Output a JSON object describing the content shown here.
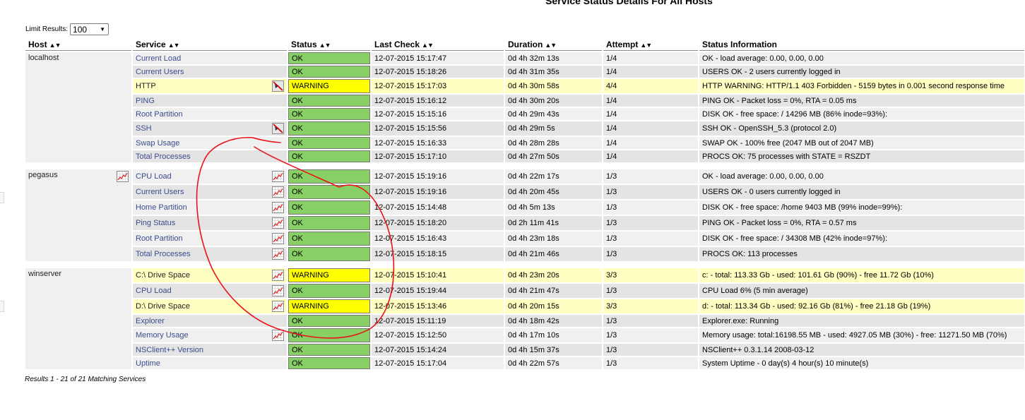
{
  "page": {
    "title": "Service Status Details For All Hosts"
  },
  "limit": {
    "label": "Limit Results:",
    "value": "100"
  },
  "columns": {
    "host": "Host",
    "service": "Service",
    "status": "Status",
    "last_check": "Last Check",
    "duration": "Duration",
    "attempt": "Attempt",
    "info": "Status Information"
  },
  "hosts": [
    {
      "name": "localhost",
      "graph_icon": false,
      "services": [
        {
          "name": "Current Load",
          "icon": "",
          "status": "OK",
          "last_check": "12-07-2015 15:17:47",
          "duration": "0d 4h 32m 13s",
          "attempt": "1/4",
          "info": "OK - load average: 0.00, 0.00, 0.00"
        },
        {
          "name": "Current Users",
          "icon": "",
          "status": "OK",
          "last_check": "12-07-2015 15:18:26",
          "duration": "0d 4h 31m 35s",
          "attempt": "1/4",
          "info": "USERS OK - 2 users currently logged in"
        },
        {
          "name": "HTTP",
          "icon": "notifications-disabled-icon",
          "status": "WARNING",
          "last_check": "12-07-2015 15:17:03",
          "duration": "0d 4h 30m 58s",
          "attempt": "4/4",
          "info": "HTTP WARNING: HTTP/1.1 403 Forbidden - 5159 bytes in 0.001 second response time"
        },
        {
          "name": "PING",
          "icon": "",
          "status": "OK",
          "last_check": "12-07-2015 15:16:12",
          "duration": "0d 4h 30m 20s",
          "attempt": "1/4",
          "info": "PING OK - Packet loss = 0%, RTA = 0.05 ms"
        },
        {
          "name": "Root Partition",
          "icon": "",
          "status": "OK",
          "last_check": "12-07-2015 15:15:16",
          "duration": "0d 4h 29m 43s",
          "attempt": "1/4",
          "info": "DISK OK - free space: / 14296 MB (86% inode=93%):"
        },
        {
          "name": "SSH",
          "icon": "notifications-disabled-icon",
          "status": "OK",
          "last_check": "12-07-2015 15:15:56",
          "duration": "0d 4h 29m 5s",
          "attempt": "1/4",
          "info": "SSH OK - OpenSSH_5.3 (protocol 2.0)"
        },
        {
          "name": "Swap Usage",
          "icon": "",
          "status": "OK",
          "last_check": "12-07-2015 15:16:33",
          "duration": "0d 4h 28m 28s",
          "attempt": "1/4",
          "info": "SWAP OK - 100% free (2047 MB out of 2047 MB)"
        },
        {
          "name": "Total Processes",
          "icon": "",
          "status": "OK",
          "last_check": "12-07-2015 15:17:10",
          "duration": "0d 4h 27m 50s",
          "attempt": "1/4",
          "info": "PROCS OK: 75 processes with STATE = RSZDT"
        }
      ]
    },
    {
      "name": "pegasus",
      "graph_icon": true,
      "services": [
        {
          "name": "CPU Load",
          "icon": "graph-icon",
          "status": "OK",
          "last_check": "12-07-2015 15:19:16",
          "duration": "0d 4h 22m 17s",
          "attempt": "1/3",
          "info": "OK - load average: 0.00, 0.00, 0.00"
        },
        {
          "name": "Current Users",
          "icon": "graph-icon",
          "status": "OK",
          "last_check": "12-07-2015 15:19:16",
          "duration": "0d 4h 20m 45s",
          "attempt": "1/3",
          "info": "USERS OK - 0 users currently logged in"
        },
        {
          "name": "Home Partition",
          "icon": "graph-icon",
          "status": "OK",
          "last_check": "12-07-2015 15:14:48",
          "duration": "0d 4h 5m 13s",
          "attempt": "1/3",
          "info": "DISK OK - free space: /home 9403 MB (99% inode=99%):"
        },
        {
          "name": "Ping Status",
          "icon": "graph-icon",
          "status": "OK",
          "last_check": "12-07-2015 15:18:20",
          "duration": "0d 2h 11m 41s",
          "attempt": "1/3",
          "info": "PING OK - Packet loss = 0%, RTA = 0.57 ms"
        },
        {
          "name": "Root Partition",
          "icon": "graph-icon",
          "status": "OK",
          "last_check": "12-07-2015 15:16:43",
          "duration": "0d 4h 23m 18s",
          "attempt": "1/3",
          "info": "DISK OK - free space: / 34308 MB (42% inode=97%):"
        },
        {
          "name": "Total Processes",
          "icon": "graph-icon",
          "status": "OK",
          "last_check": "12-07-2015 15:18:15",
          "duration": "0d 4h 21m 46s",
          "attempt": "1/3",
          "info": "PROCS OK: 113 processes"
        }
      ]
    },
    {
      "name": "winserver",
      "graph_icon": false,
      "services": [
        {
          "name": "C:\\ Drive Space",
          "icon": "graph-icon",
          "status": "WARNING",
          "last_check": "12-07-2015 15:10:41",
          "duration": "0d 4h 23m 20s",
          "attempt": "3/3",
          "info": "c: - total: 113.33 Gb - used: 101.61 Gb (90%) - free 11.72 Gb (10%)"
        },
        {
          "name": "CPU Load",
          "icon": "graph-icon",
          "status": "OK",
          "last_check": "12-07-2015 15:19:44",
          "duration": "0d 4h 21m 47s",
          "attempt": "1/3",
          "info": "CPU Load 6% (5 min average)"
        },
        {
          "name": "D:\\ Drive Space",
          "icon": "graph-icon",
          "status": "WARNING",
          "last_check": "12-07-2015 15:13:46",
          "duration": "0d 4h 20m 15s",
          "attempt": "3/3",
          "info": "d: - total: 113.34 Gb - used: 92.16 Gb (81%) - free 21.18 Gb (19%)"
        },
        {
          "name": "Explorer",
          "icon": "",
          "status": "OK",
          "last_check": "12-07-2015 15:11:19",
          "duration": "0d 4h 18m 42s",
          "attempt": "1/3",
          "info": "Explorer.exe: Running"
        },
        {
          "name": "Memory Usage",
          "icon": "graph-icon",
          "status": "OK",
          "last_check": "12-07-2015 15:12:50",
          "duration": "0d 4h 17m 10s",
          "attempt": "1/3",
          "info": "Memory usage: total:16198.55 MB - used: 4927.05 MB (30%) - free: 11271.50 MB (70%)"
        },
        {
          "name": "NSClient++ Version",
          "icon": "",
          "status": "OK",
          "last_check": "12-07-2015 15:14:24",
          "duration": "0d 4h 15m 37s",
          "attempt": "1/3",
          "info": "NSClient++ 0.3.1.14 2008-03-12"
        },
        {
          "name": "Uptime",
          "icon": "",
          "status": "OK",
          "last_check": "12-07-2015 15:17:04",
          "duration": "0d 4h 22m 57s",
          "attempt": "1/3",
          "info": "System Uptime - 0 day(s) 4 hour(s) 10 minute(s)"
        }
      ]
    }
  ],
  "footer": {
    "results": "Results 1 - 21 of 21 Matching Services"
  },
  "colors": {
    "ok": "#88d066",
    "warning": "#ffff00",
    "warning_row": "#feffc1",
    "link": "#3b4c8c",
    "annotation": "#e8141a"
  }
}
